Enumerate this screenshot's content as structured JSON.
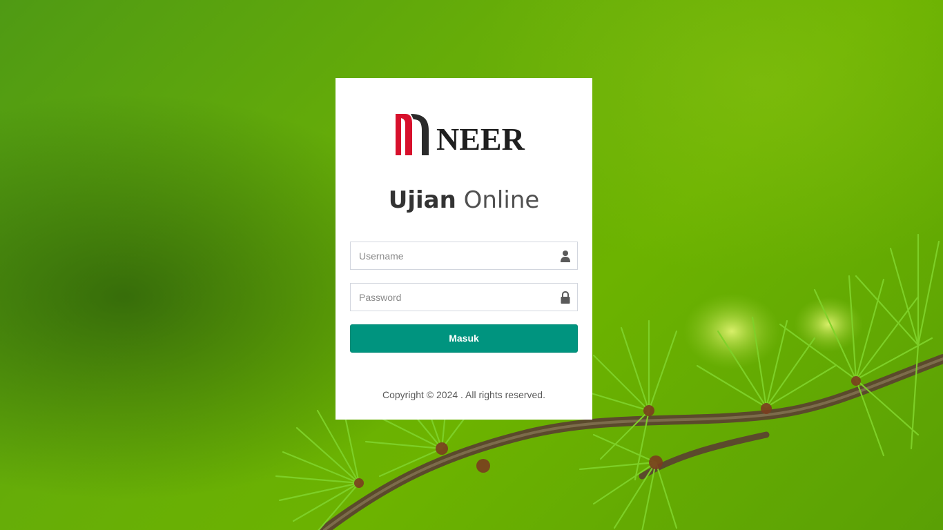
{
  "brand": {
    "name": "NEER",
    "mark_colors": [
      "#d7102c",
      "#2a2a2a"
    ]
  },
  "title": {
    "bold": "Ujian",
    "light": "Online"
  },
  "form": {
    "username": {
      "placeholder": "Username",
      "value": "",
      "icon": "user-icon"
    },
    "password": {
      "placeholder": "Password",
      "value": "",
      "icon": "lock-icon"
    },
    "submit_label": "Masuk"
  },
  "footer": {
    "copyright": "Copyright © 2024 . All rights reserved."
  },
  "colors": {
    "accent": "#00947f",
    "background": "#66ad08"
  }
}
